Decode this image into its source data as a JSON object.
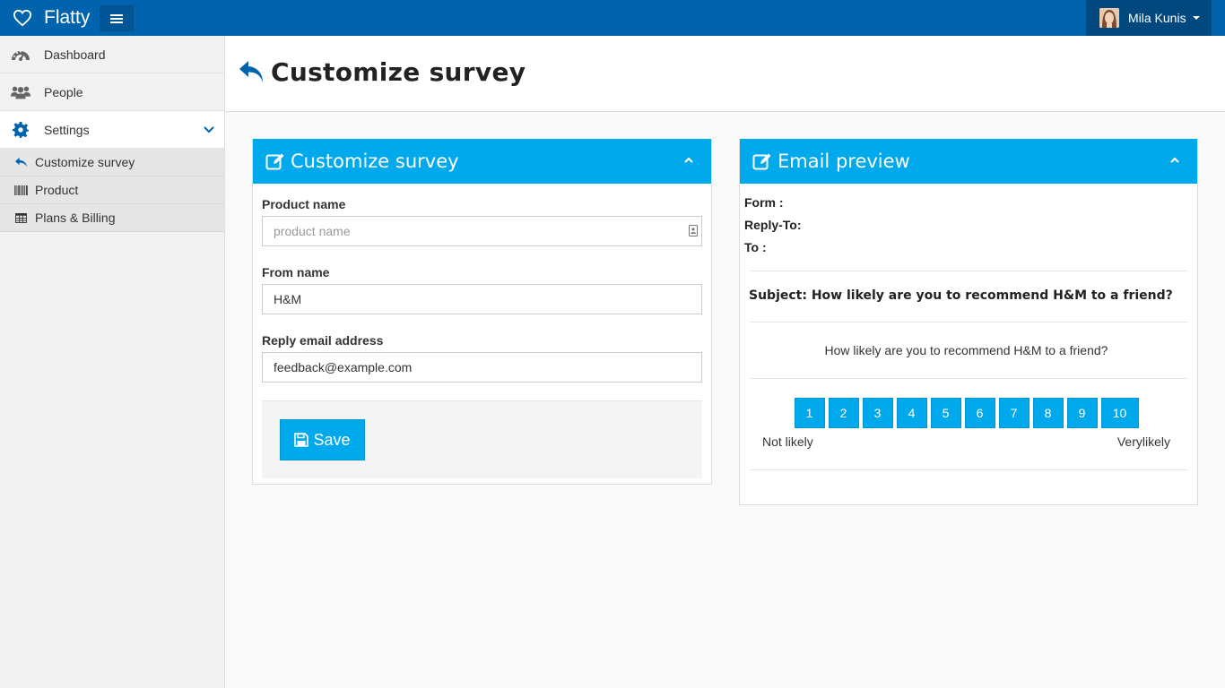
{
  "app": {
    "brand": "Flatty"
  },
  "user": {
    "name": "Mila Kunis"
  },
  "sidebar": {
    "items": [
      {
        "label": "Dashboard",
        "icon": "dashboard-icon"
      },
      {
        "label": "People",
        "icon": "people-icon"
      },
      {
        "label": "Settings",
        "icon": "gear-icon"
      }
    ],
    "subitems": [
      {
        "label": "Customize survey",
        "icon": "reply-icon"
      },
      {
        "label": "Product",
        "icon": "barcode-icon"
      },
      {
        "label": "Plans & Billing",
        "icon": "table-icon"
      }
    ]
  },
  "page": {
    "title": "Customize survey"
  },
  "form_box": {
    "title": "Customize survey",
    "product_label": "Product name",
    "product_value": "",
    "product_placeholder": "product name",
    "from_label": "From name",
    "from_value": "H&M",
    "reply_label": "Reply email address",
    "reply_value": "feedback@example.com",
    "save_label": "Save"
  },
  "preview_box": {
    "title": "Email preview",
    "form_line": "Form :",
    "reply_to_line": "Reply-To:",
    "to_line": "To :",
    "subject": "Subject: How likely are you to recommend H&M to a friend?",
    "question": "How likely are you to recommend H&M to a friend?",
    "scores": [
      "1",
      "2",
      "3",
      "4",
      "5",
      "6",
      "7",
      "8",
      "9",
      "10"
    ],
    "low_label": "Not likely",
    "high_label": "Verylikely"
  },
  "colors": {
    "navbar": "#0063ad",
    "accent": "#00a8ec",
    "user_menu": "#00487e"
  }
}
